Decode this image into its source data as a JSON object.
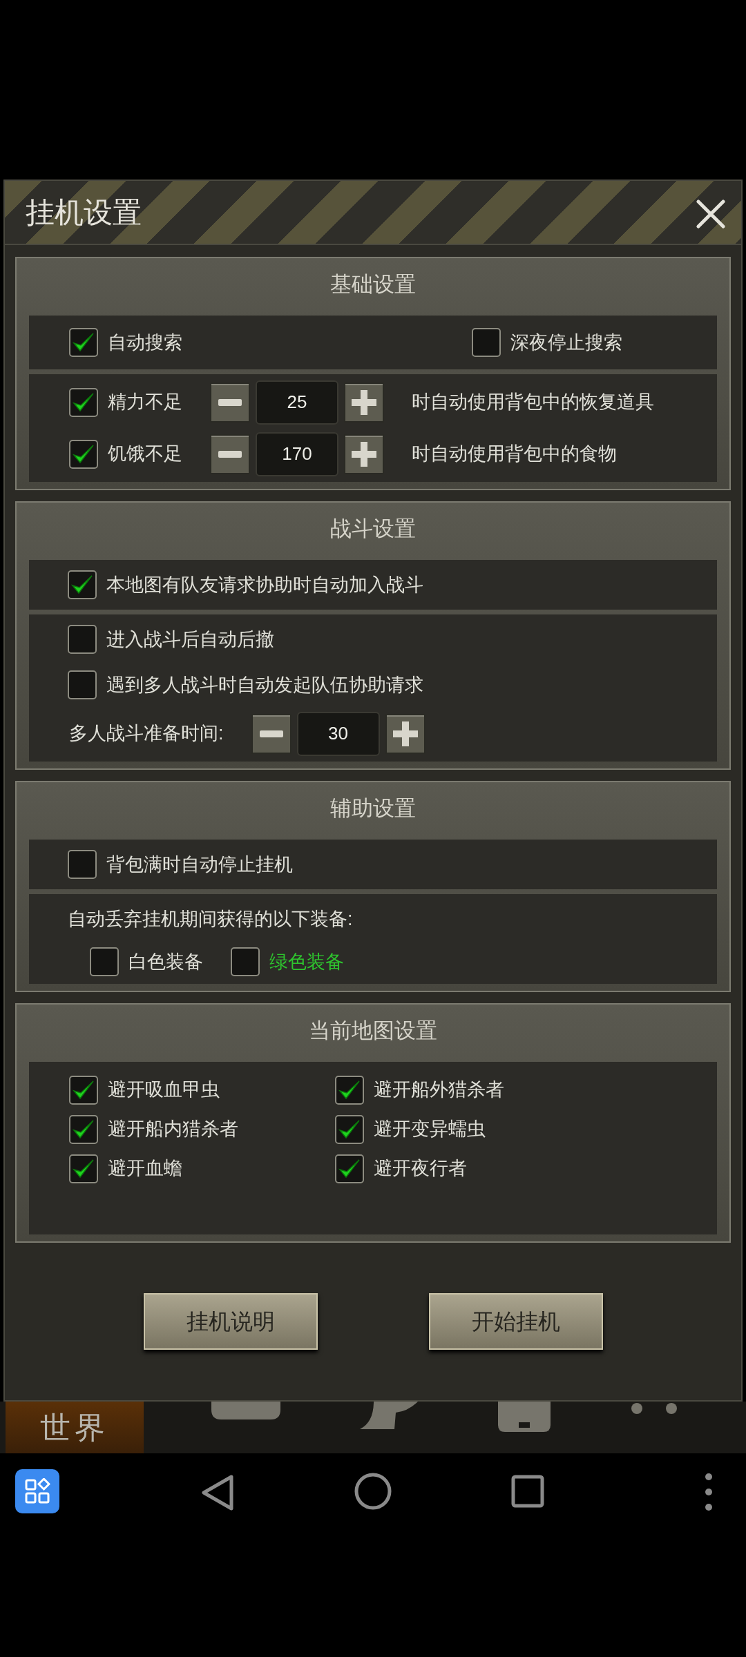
{
  "dialog": {
    "title": "挂机设置",
    "sections": [
      {
        "title": "基础设置",
        "groups": [
          {
            "rows": [
              {
                "kind": "split",
                "items": [
                  {
                    "kind": "checkbox",
                    "label": "自动搜索",
                    "checked": true
                  },
                  {
                    "kind": "checkbox",
                    "label": "深夜停止搜索",
                    "checked": false
                  }
                ]
              }
            ]
          },
          {
            "rows": [
              {
                "kind": "inline",
                "items": [
                  {
                    "kind": "checkbox",
                    "label": "精力不足",
                    "checked": true
                  },
                  {
                    "kind": "stepper",
                    "value": "25"
                  },
                  {
                    "kind": "text",
                    "text": "时自动使用背包中的恢复道具"
                  }
                ]
              },
              {
                "kind": "inline",
                "items": [
                  {
                    "kind": "checkbox",
                    "label": "饥饿不足",
                    "checked": true
                  },
                  {
                    "kind": "stepper",
                    "value": "170"
                  },
                  {
                    "kind": "text",
                    "text": "时自动使用背包中的食物"
                  }
                ]
              }
            ]
          }
        ]
      },
      {
        "title": "战斗设置",
        "groups": [
          {
            "rows": [
              {
                "kind": "single",
                "items": [
                  {
                    "kind": "checkbox",
                    "label": "本地图有队友请求协助时自动加入战斗",
                    "checked": true
                  }
                ]
              }
            ]
          },
          {
            "rows": [
              {
                "kind": "single",
                "items": [
                  {
                    "kind": "checkbox",
                    "label": "进入战斗后自动后撤",
                    "checked": false
                  }
                ]
              },
              {
                "kind": "single",
                "items": [
                  {
                    "kind": "checkbox",
                    "label": "遇到多人战斗时自动发起队伍协助请求",
                    "checked": false
                  }
                ]
              },
              {
                "kind": "inline",
                "items": [
                  {
                    "kind": "text",
                    "text": "多人战斗准备时间:"
                  },
                  {
                    "kind": "stepper",
                    "value": "30"
                  }
                ]
              }
            ]
          }
        ]
      },
      {
        "title": "辅助设置",
        "groups": [
          {
            "rows": [
              {
                "kind": "single",
                "items": [
                  {
                    "kind": "checkbox",
                    "label": "背包满时自动停止挂机",
                    "checked": false
                  }
                ]
              }
            ]
          },
          {
            "rows": [
              {
                "kind": "single",
                "items": [
                  {
                    "kind": "text",
                    "text": "自动丢弃挂机期间获得的以下装备:"
                  }
                ]
              },
              {
                "kind": "indent",
                "items": [
                  {
                    "kind": "checkbox",
                    "label": "白色装备",
                    "checked": false,
                    "color": "#e0e0d8"
                  },
                  {
                    "kind": "checkbox",
                    "label": "绿色装备",
                    "checked": false,
                    "color": "#2ec52e"
                  }
                ]
              }
            ]
          }
        ]
      },
      {
        "title": "当前地图设置",
        "groups": [
          {
            "rows": [
              {
                "kind": "pair",
                "items": [
                  {
                    "kind": "checkbox",
                    "label": "避开吸血甲虫",
                    "checked": true
                  },
                  {
                    "kind": "checkbox",
                    "label": "避开船外猎杀者",
                    "checked": true
                  }
                ]
              },
              {
                "kind": "pair",
                "items": [
                  {
                    "kind": "checkbox",
                    "label": "避开船内猎杀者",
                    "checked": true
                  },
                  {
                    "kind": "checkbox",
                    "label": "避开变异蠕虫",
                    "checked": true
                  }
                ]
              },
              {
                "kind": "pair",
                "items": [
                  {
                    "kind": "checkbox",
                    "label": "避开血蟾",
                    "checked": true
                  },
                  {
                    "kind": "checkbox",
                    "label": "避开夜行者",
                    "checked": true
                  }
                ]
              }
            ]
          }
        ]
      }
    ],
    "buttons": [
      "挂机说明",
      "开始挂机"
    ]
  },
  "bottom_tabs": [
    {
      "label": "世界",
      "selected": true
    }
  ]
}
